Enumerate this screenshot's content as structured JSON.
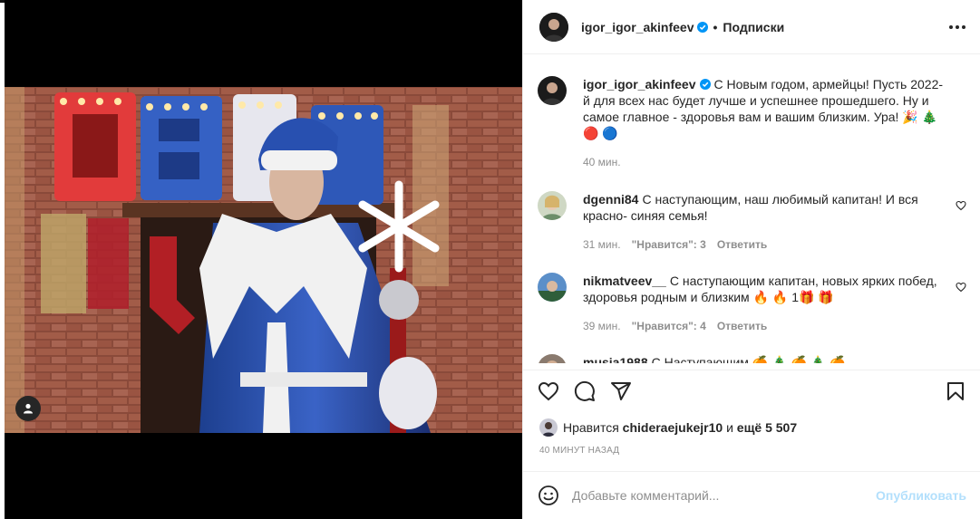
{
  "post": {
    "author": "igor_igor_akinfeev",
    "follow_state": "Подписки",
    "caption_user": "igor_igor_akinfeev",
    "caption_text": "С Новым годом, армейцы! Пусть 2022-й для всех нас будет лучше и успешнее прошедшего. Ну и самое главное - здоровья вам и вашим близким. Ура! 🎉 🎄 🔴 🔵",
    "caption_time": "40 мин."
  },
  "comments": [
    {
      "user": "dgenni84",
      "text": "С наступающим, наш любимый капитан! И вся красно- синяя семья!",
      "time": "31 мин.",
      "likes": "\"Нравится\": 3",
      "reply": "Ответить"
    },
    {
      "user": "nikmatveev__",
      "text": "С наступающим капитан, новых ярких побед, здоровья родным и близким 🔥 🔥 1🎁 🎁",
      "time": "39 мин.",
      "likes": "\"Нравится\": 4",
      "reply": "Ответить"
    },
    {
      "user": "musja1988",
      "text": "С Наступающим 🍊 🎄 🍊 🎄 🍊"
    }
  ],
  "likes": {
    "prefix": "Нравится",
    "user": "chideraejukejr10",
    "connector": "и",
    "rest": "ещё 5 507"
  },
  "timestamp": "40 МИНУТ НАЗАД",
  "comment_box": {
    "placeholder": "Добавьте комментарий...",
    "publish": "Опубликовать"
  },
  "icons": [
    "more-icon",
    "verified-icon",
    "heart-icon",
    "comment-icon",
    "share-icon",
    "bookmark-icon",
    "emoji-icon",
    "user-tag-icon"
  ],
  "colors": {
    "verified": "#0095f6",
    "publish_disabled": "#b2dffc",
    "muted": "#8e8e8e",
    "text": "#262626"
  }
}
